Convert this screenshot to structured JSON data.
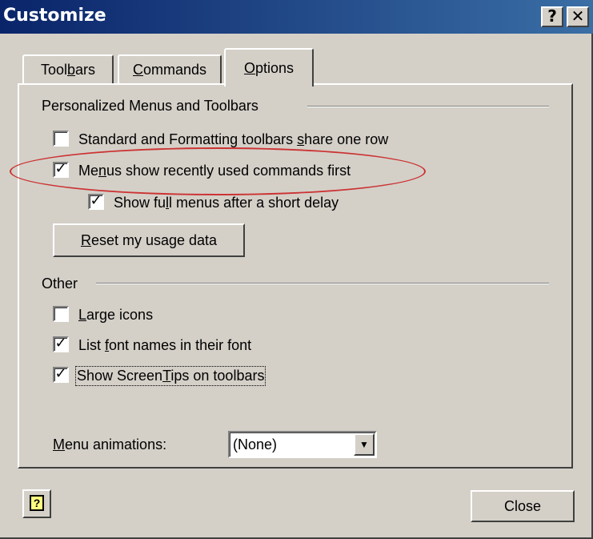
{
  "window": {
    "title": "Customize",
    "help_button": "?",
    "close_button": "✕"
  },
  "tabs": [
    {
      "label_pre": "Tool",
      "label_ul": "b",
      "label_post": "ars"
    },
    {
      "label_pre": "",
      "label_ul": "C",
      "label_post": "ommands"
    },
    {
      "label_pre": "",
      "label_ul": "O",
      "label_post": "ptions"
    }
  ],
  "personalized": {
    "header": "Personalized Menus and Toolbars",
    "cb1": {
      "pre": "Standard and Formatting toolbars ",
      "ul": "s",
      "post": "hare one row",
      "checked": false
    },
    "cb2": {
      "pre": "Me",
      "ul": "n",
      "post": "us show recently used commands first",
      "checked": true
    },
    "cb3": {
      "pre": "Show fu",
      "ul": "l",
      "post": "l menus after a short delay",
      "checked": true
    },
    "reset_button": {
      "pre": "",
      "ul": "R",
      "post": "eset my usage data"
    }
  },
  "other": {
    "header": "Other",
    "cb1": {
      "pre": "",
      "ul": "L",
      "post": "arge icons",
      "checked": false
    },
    "cb2": {
      "pre": "List ",
      "ul": "f",
      "post": "ont names in their font",
      "checked": true
    },
    "cb3": {
      "pre": "Show Screen",
      "ul": "T",
      "post": "ips on toolbars",
      "checked": true
    }
  },
  "menu_animations": {
    "label_pre": "",
    "label_ul": "M",
    "label_post": "enu animations:",
    "value": "(None)"
  },
  "footer": {
    "help_icon": "?",
    "close_label": "Close"
  },
  "check_mark": "✓",
  "annotation_color": "#cc3333"
}
